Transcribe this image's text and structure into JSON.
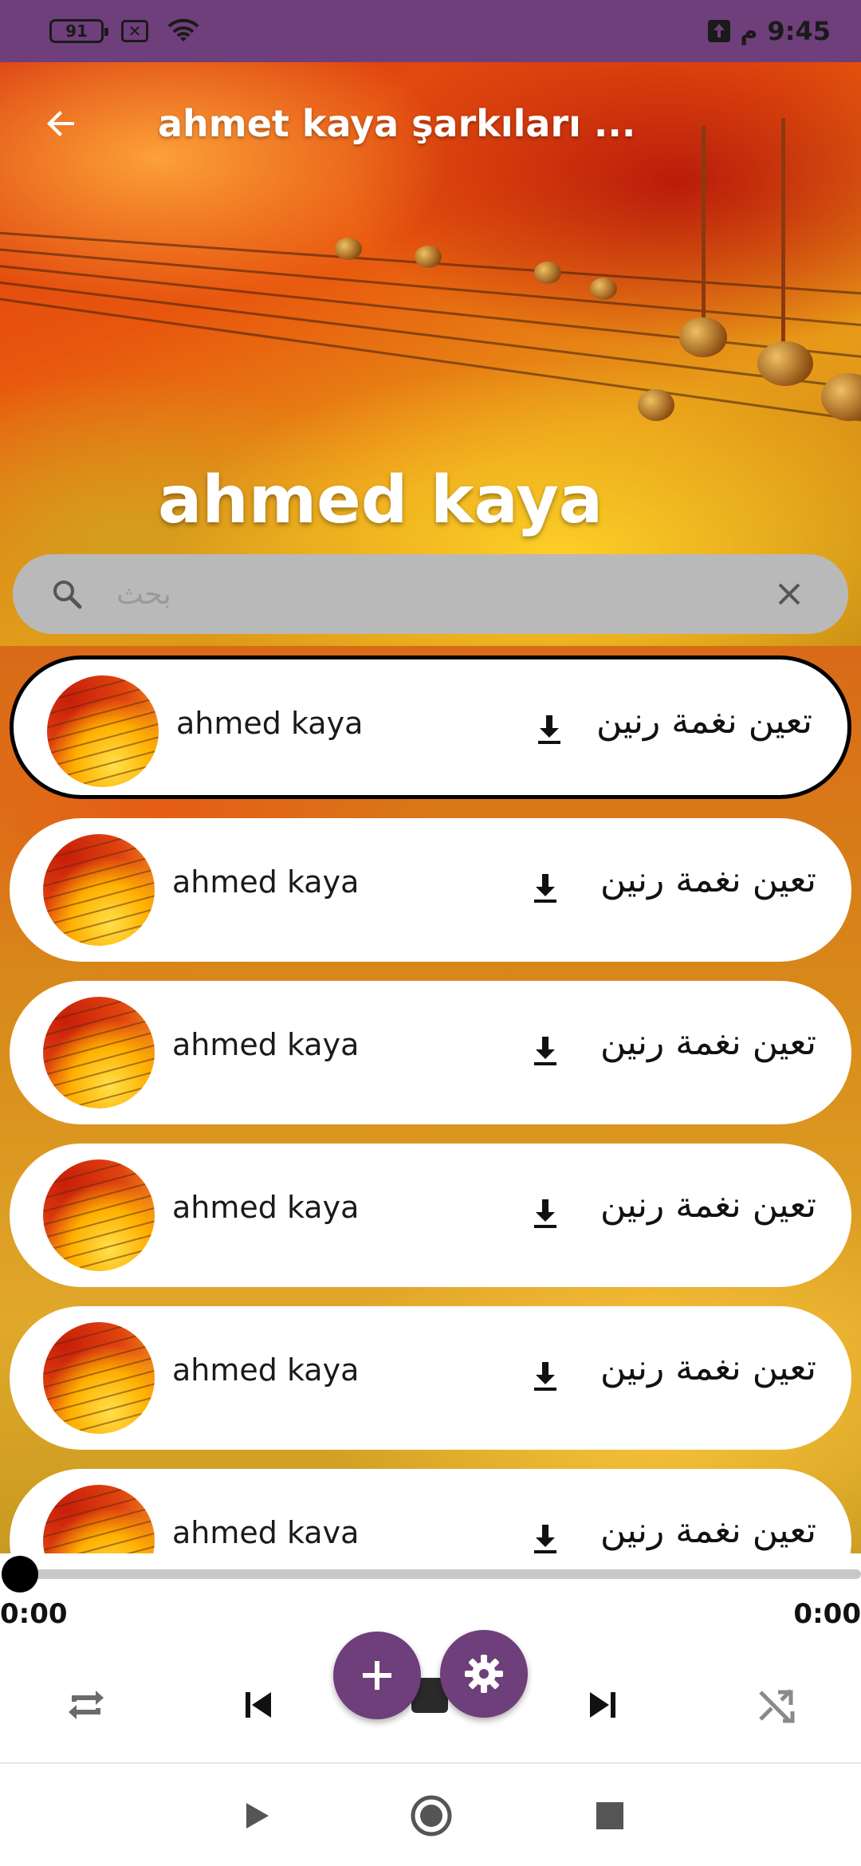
{
  "status_bar": {
    "battery": "91",
    "time": "9:45",
    "ampm": "م",
    "icons": [
      "battery-icon",
      "sim-off-icon",
      "wifi-icon",
      "upload-notification-icon"
    ]
  },
  "header": {
    "toolbar_title": "ahmet kaya şarkıları ...",
    "hero_title": "ahmed kaya",
    "back_icon": "arrow-left-icon"
  },
  "search": {
    "placeholder": "بحث",
    "value": ""
  },
  "songs": [
    {
      "title": "ahmed kaya",
      "action_label": "تعين نغمة رنين",
      "selected": true
    },
    {
      "title": "ahmed kaya",
      "action_label": "تعين نغمة رنين",
      "selected": false
    },
    {
      "title": "ahmed kaya",
      "action_label": "تعين نغمة رنين",
      "selected": false
    },
    {
      "title": "ahmed kaya",
      "action_label": "تعين نغمة رنين",
      "selected": false
    },
    {
      "title": "ahmed kaya",
      "action_label": "تعين نغمة رنين",
      "selected": false
    },
    {
      "title": "ahmed kava",
      "action_label": "تعين نغمة رنين",
      "selected": false
    }
  ],
  "player": {
    "elapsed": "0:00",
    "duration": "0:00",
    "progress": 0,
    "controls": [
      "repeat-icon",
      "skip-previous-icon",
      "add-icon",
      "stop-icon",
      "settings-icon",
      "skip-next-icon",
      "shuffle-icon"
    ]
  },
  "colors": {
    "accent": "#6e3f7a",
    "status_bar": "#6e3f7a",
    "search_bg": "#b9b9b9"
  }
}
